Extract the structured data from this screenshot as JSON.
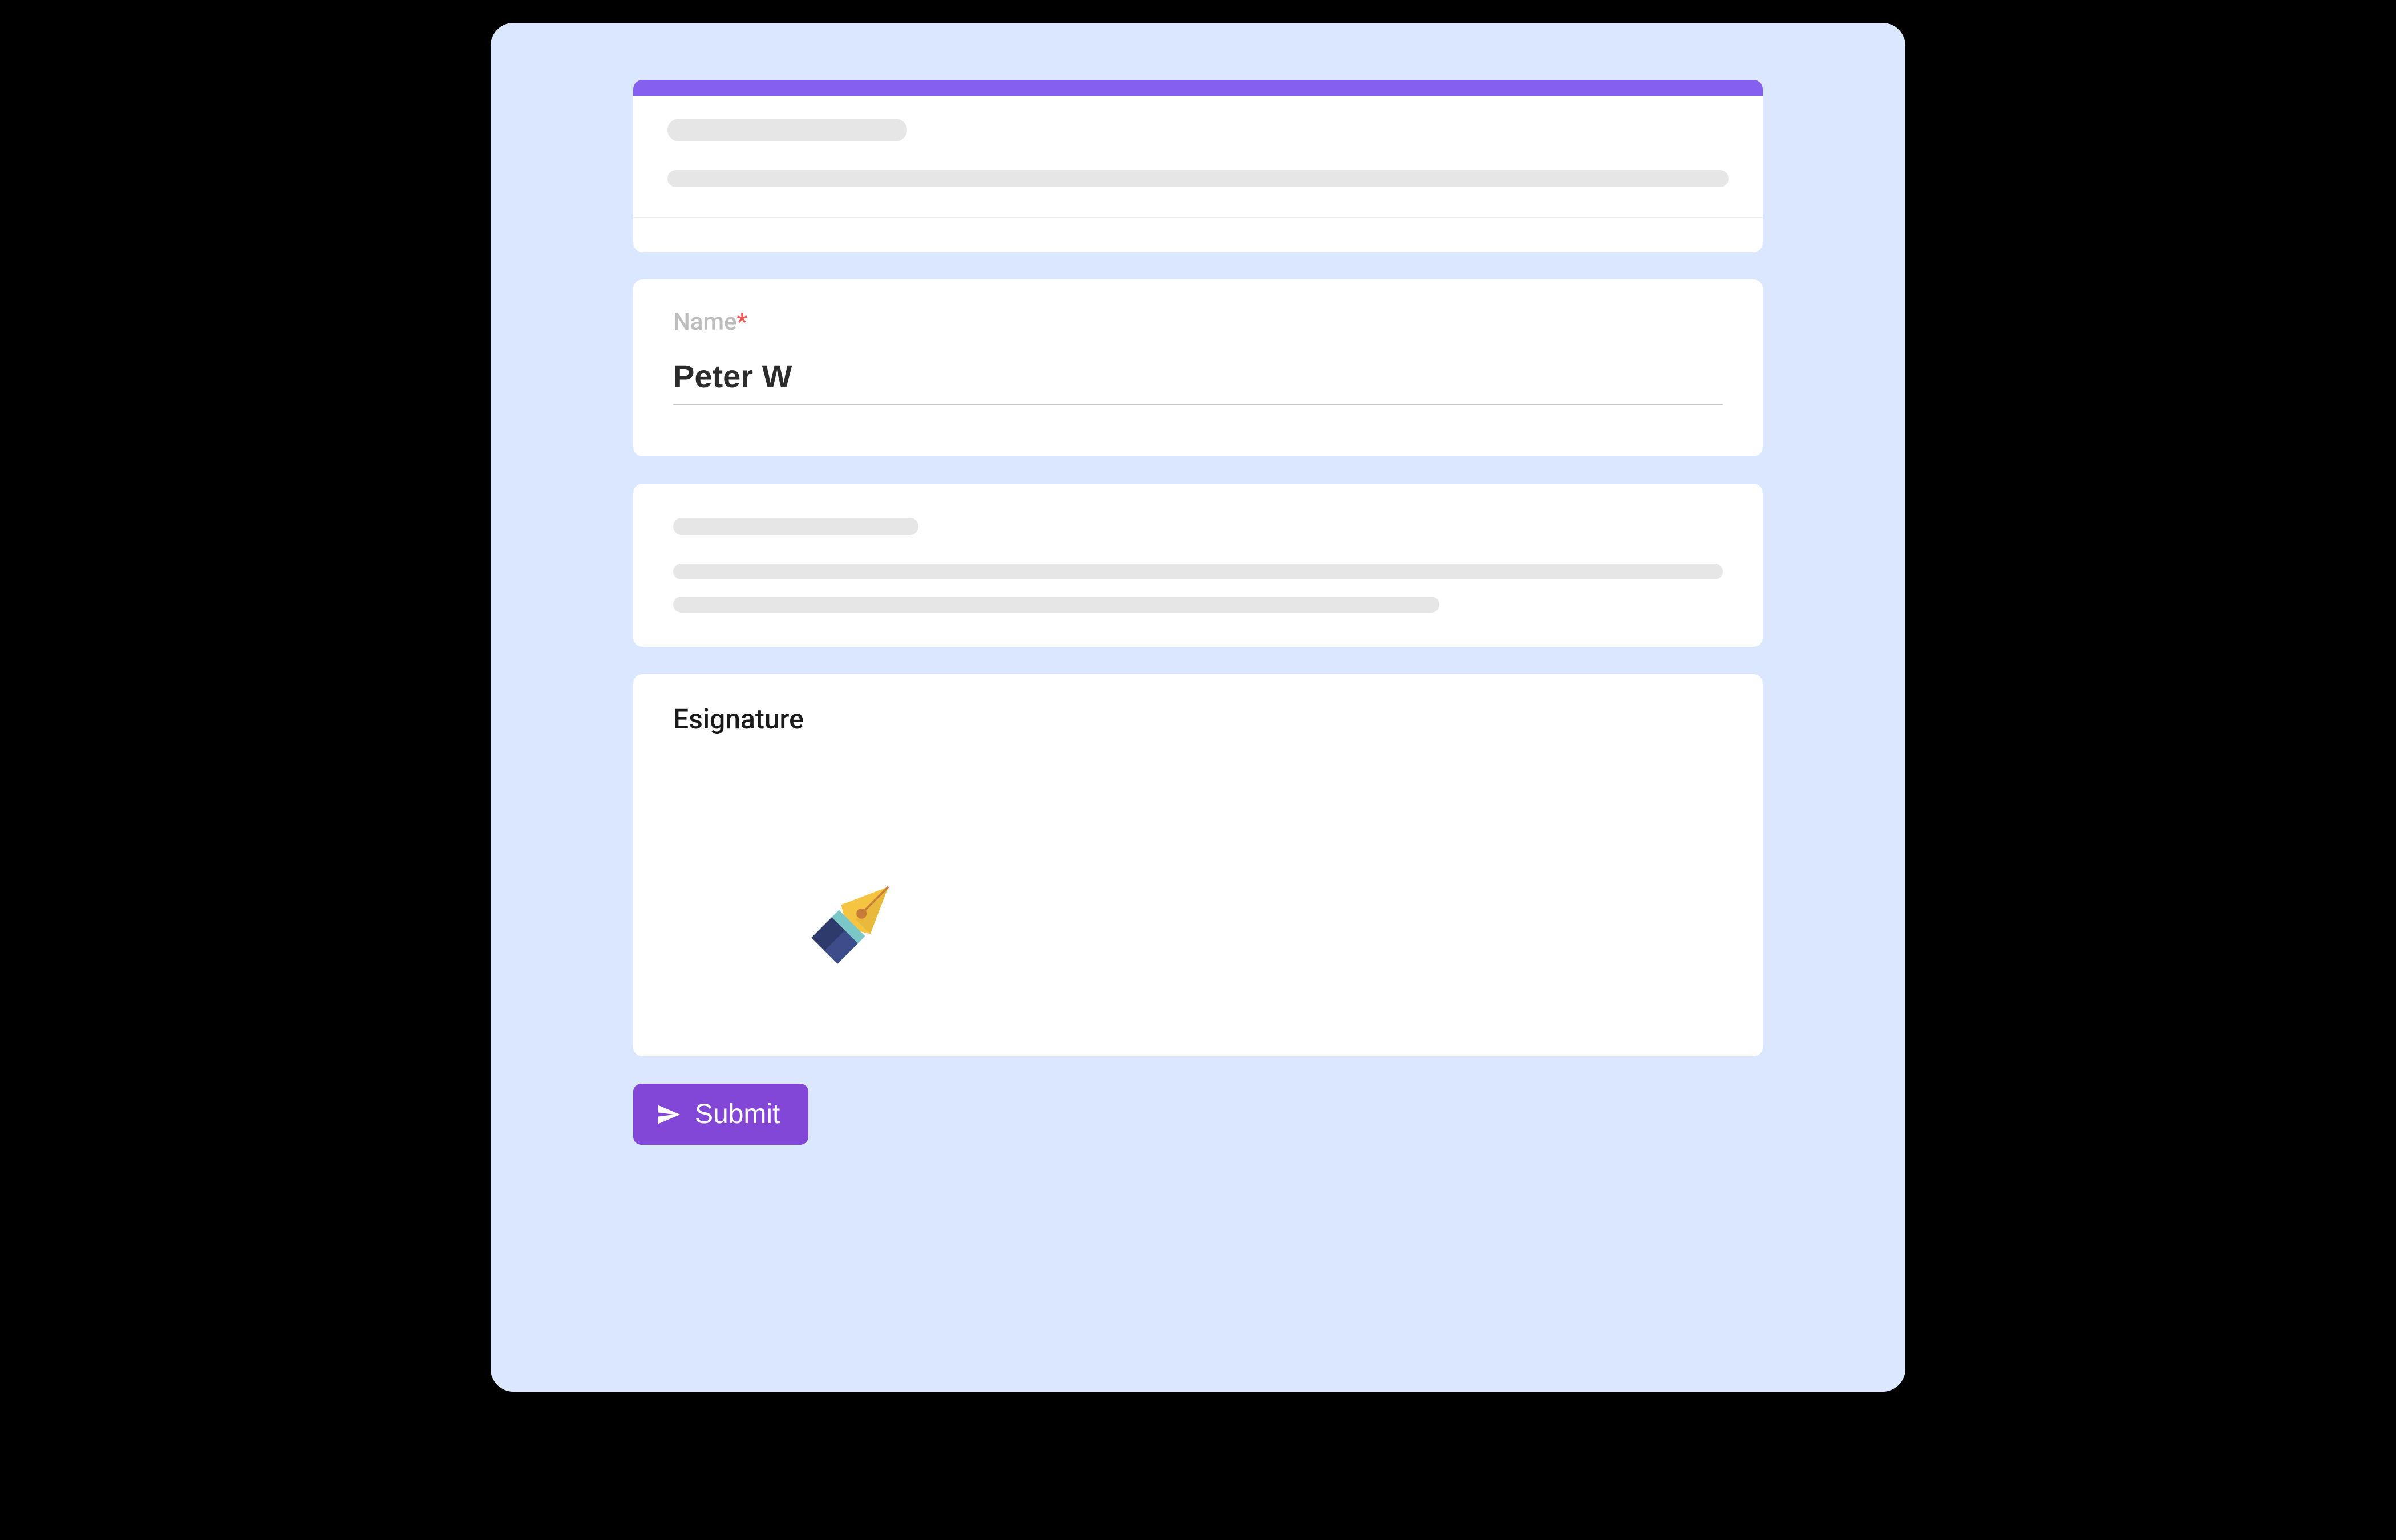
{
  "colors": {
    "accent": "#8560f0",
    "button": "#8247d6",
    "background": "#dbe6ff",
    "required": "#ff5252"
  },
  "fields": {
    "name": {
      "label": "Name",
      "required_mark": "*",
      "value": "Peter W"
    },
    "esignature": {
      "label": "Esignature"
    }
  },
  "actions": {
    "submit_label": "Submit"
  }
}
